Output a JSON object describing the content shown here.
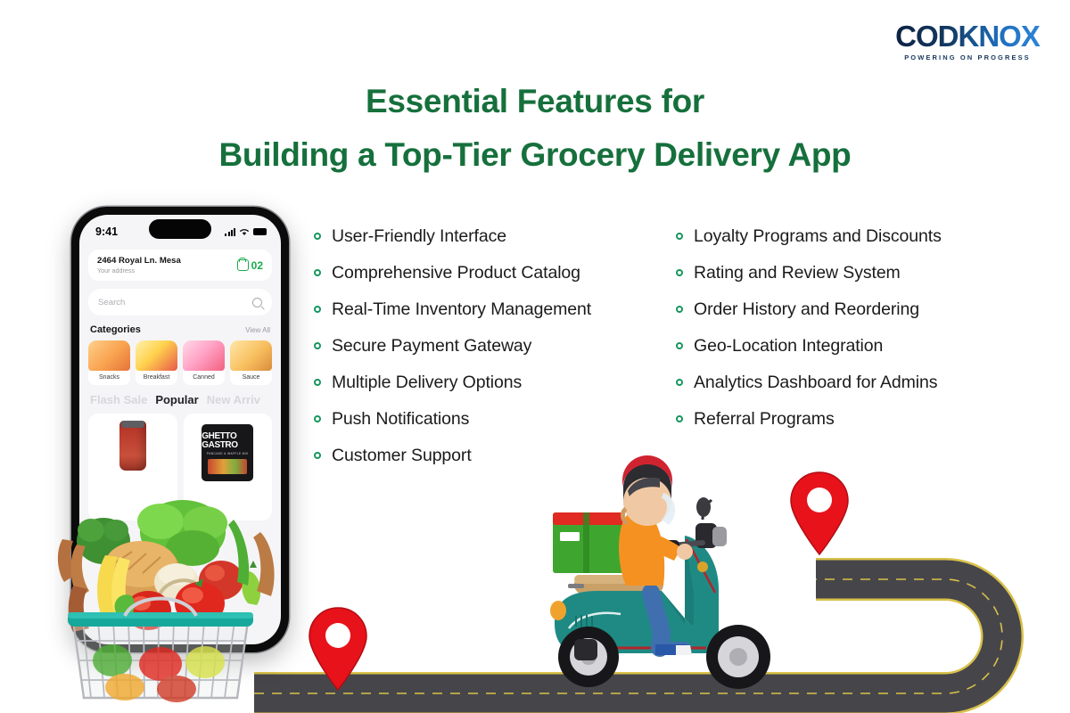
{
  "brand": {
    "name": "CODKNOX",
    "tagline": "POWERING ON PROGRESS",
    "color": "#13355c"
  },
  "title": {
    "line1": "Essential Features for",
    "line2": "Building a Top-Tier Grocery Delivery App",
    "color": "#16703c"
  },
  "features": {
    "bullet_color": "#17965e",
    "left": [
      "User-Friendly Interface",
      "Comprehensive Product Catalog",
      "Real-Time Inventory Management",
      "Secure Payment Gateway",
      "Multiple Delivery Options",
      "Push Notifications",
      "Customer Support"
    ],
    "right": [
      "Loyalty Programs and Discounts",
      "Rating and Review System",
      "Order History and Reordering",
      "Geo-Location Integration",
      "Analytics Dashboard for Admins",
      "Referral Programs"
    ]
  },
  "phone": {
    "status": {
      "time": "9:41",
      "signal_icon": "signal-bars-icon",
      "wifi_icon": "wifi-icon",
      "battery_icon": "battery-icon"
    },
    "address": {
      "main": "2464 Royal Ln. Mesa",
      "sub": "Your address"
    },
    "cart": {
      "icon": "shopping-bag-icon",
      "count": "02",
      "color": "#1bab4e"
    },
    "search": {
      "placeholder": "Search",
      "icon": "search-icon"
    },
    "categories_header": {
      "title": "Categories",
      "link": "View All"
    },
    "categories": [
      {
        "label": "Snacks"
      },
      {
        "label": "Breakfast"
      },
      {
        "label": "Canned"
      },
      {
        "label": "Sauce"
      }
    ],
    "tabs": [
      {
        "label": "Flash Sale",
        "active": false
      },
      {
        "label": "Popular",
        "active": true
      },
      {
        "label": "New Arriv",
        "active": false
      }
    ],
    "products": [
      {
        "name": "",
        "type": "sauce-jar"
      },
      {
        "name": "GHETTO GASTRO",
        "sub": "PANCAKE & WAFFLE MIX",
        "type": "can"
      }
    ]
  },
  "illustration": {
    "road": {
      "surface_color": "#46464a",
      "line_color": "#d9c14a",
      "pins": 2
    },
    "pin_color": "#e8121a",
    "scooter": {
      "body_color": "#1f8a84",
      "rider_top_color": "#f59120",
      "box_color": "#3ea62e",
      "box_lid_color": "#e02a22"
    },
    "basket": {
      "handle_color": "#17a89c"
    },
    "labels": {
      "pin_start": "",
      "pin_end": ""
    }
  }
}
